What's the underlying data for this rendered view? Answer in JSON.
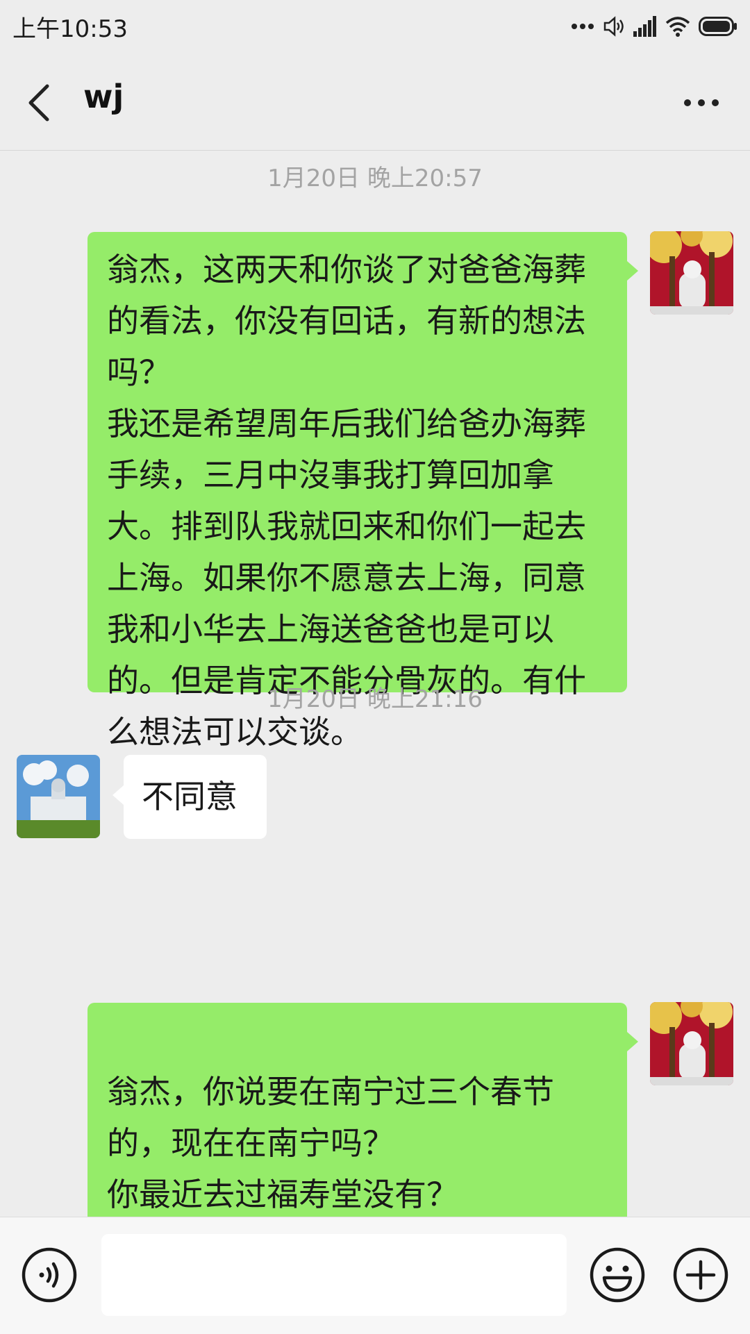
{
  "status_bar": {
    "time": "上午10:53",
    "icons": [
      "more-dots-icon",
      "volume-icon",
      "signal-icon",
      "wifi-icon",
      "battery-icon"
    ]
  },
  "header": {
    "title": "wj",
    "back_icon": "back-chevron-icon",
    "more_icon": "more-options-icon"
  },
  "messages": [
    {
      "type": "timestamp",
      "text": "1月20日 晚上20:57"
    },
    {
      "type": "message",
      "sender": "me",
      "text": "翁杰，这两天和你谈了对爸爸海葬的看法，你没有回话，有新的想法吗？\n我还是希望周年后我们给爸办海葬手续，三月中沒事我打算回加拿大。排到队我就回来和你们一起去上海。如果你不愿意去上海，同意我和小华去上海送爸爸也是可以的。但是肯定不能分骨灰的。有什么想法可以交谈。"
    },
    {
      "type": "timestamp",
      "text": "1月20日 晚上21:16"
    },
    {
      "type": "message",
      "sender": "them",
      "text": "不同意"
    },
    {
      "type": "message",
      "sender": "me",
      "text": "\n翁杰，你说要在南宁过三个春节的，现在在南宁吗？\n你最近去过福寿堂没有？"
    }
  ],
  "input_bar": {
    "placeholder": "",
    "voice_icon": "voice-input-icon",
    "emoji_icon": "emoji-icon",
    "plus_icon": "plus-icon"
  },
  "colors": {
    "background": "#ededed",
    "my_bubble": "#95ec69",
    "their_bubble": "#ffffff",
    "timestamp_text": "#a3a3a3"
  }
}
